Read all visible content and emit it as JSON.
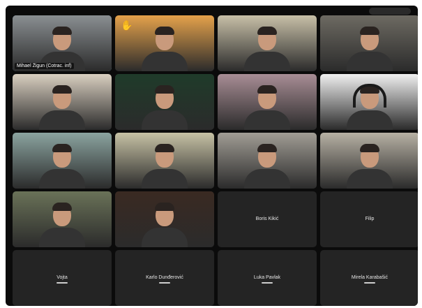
{
  "participants": [
    {
      "row": 0,
      "col": 0,
      "name": "Mihael Žigun (Cotrac. inf)",
      "tone": "#8a8f92",
      "active": true,
      "video": true
    },
    {
      "row": 0,
      "col": 1,
      "name": "",
      "tone": "#e5a24b",
      "video": true,
      "hand": true
    },
    {
      "row": 0,
      "col": 2,
      "name": "",
      "tone": "#c8c0a8",
      "video": true
    },
    {
      "row": 0,
      "col": 3,
      "name": "",
      "tone": "#6d6a62",
      "video": true
    },
    {
      "row": 1,
      "col": 0,
      "name": "",
      "tone": "#d9cfc0",
      "video": true
    },
    {
      "row": 1,
      "col": 1,
      "name": "",
      "tone": "#1f3b2a",
      "video": true
    },
    {
      "row": 1,
      "col": 2,
      "name": "",
      "tone": "#a88d95",
      "video": true
    },
    {
      "row": 1,
      "col": 3,
      "name": "",
      "tone": "#f0f0f0",
      "video": true,
      "headphones": true
    },
    {
      "row": 2,
      "col": 0,
      "name": "",
      "tone": "#8ba4a0",
      "video": true
    },
    {
      "row": 2,
      "col": 1,
      "name": "",
      "tone": "#c7c2a5",
      "video": true
    },
    {
      "row": 2,
      "col": 2,
      "name": "",
      "tone": "#a19d95",
      "video": true
    },
    {
      "row": 2,
      "col": 3,
      "name": "",
      "tone": "#b7b1a4",
      "video": true
    },
    {
      "row": 3,
      "col": 0,
      "name": "",
      "tone": "#6a7258",
      "video": true
    },
    {
      "row": 3,
      "col": 1,
      "name": "",
      "tone": "#3a2a22",
      "video": true
    },
    {
      "row": 3,
      "col": 2,
      "name": "Boris Kikić",
      "video": false
    },
    {
      "row": 3,
      "col": 3,
      "name": "Filip",
      "video": false
    },
    {
      "row": 4,
      "col": 0,
      "name": "Vojta",
      "video": false
    },
    {
      "row": 4,
      "col": 1,
      "name": "Karlo Dunđerović",
      "video": false
    },
    {
      "row": 4,
      "col": 2,
      "name": "Luka Pavlak",
      "video": false
    },
    {
      "row": 4,
      "col": 3,
      "name": "Mirela Karabašić",
      "video": false
    }
  ],
  "colors": {
    "background": "#0b0b0b",
    "tile_off": "#242424",
    "active_outline": "#7fb3e8",
    "hand": "#f3b21f"
  }
}
